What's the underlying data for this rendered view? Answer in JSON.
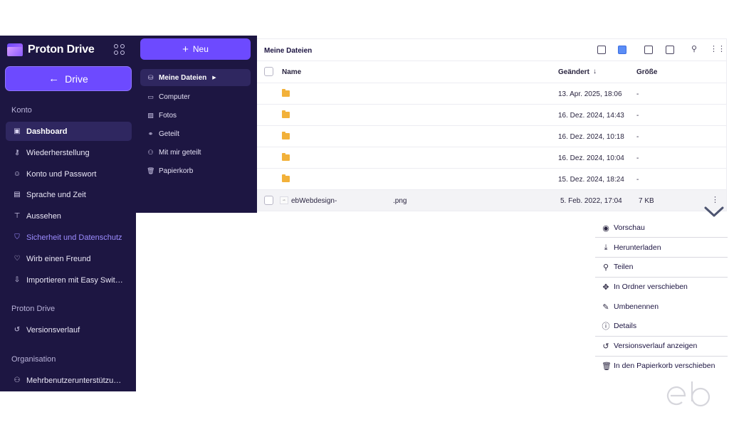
{
  "brand": {
    "name": "Proton Drive"
  },
  "sidebar": {
    "back_label": "Drive",
    "sections": {
      "konto": "Konto",
      "proton_drive": "Proton Drive",
      "organisation": "Organisation"
    },
    "items": [
      {
        "label": "Dashboard",
        "icon": "dashboard-icon"
      },
      {
        "label": "Wiederherstellung",
        "icon": "key-icon"
      },
      {
        "label": "Konto und Passwort",
        "icon": "user-icon"
      },
      {
        "label": "Sprache und Zeit",
        "icon": "language-icon"
      },
      {
        "label": "Aussehen",
        "icon": "paint-roller-icon"
      },
      {
        "label": "Sicherheit und Datenschutz",
        "icon": "shield-icon"
      },
      {
        "label": "Wirb einen Freund",
        "icon": "heart-icon"
      },
      {
        "label": "Importieren mit Easy Swit…",
        "icon": "import-icon"
      },
      {
        "label": "Versionsverlauf",
        "icon": "history-icon"
      },
      {
        "label": "Mehrbenutzerunterstützu…",
        "icon": "users-icon"
      }
    ]
  },
  "drive_nav": {
    "new_label": "Neu",
    "items": [
      {
        "label": "Meine Dateien",
        "icon": "drive-icon"
      },
      {
        "label": "Computer",
        "icon": "computer-icon"
      },
      {
        "label": "Fotos",
        "icon": "image-icon"
      },
      {
        "label": "Geteilt",
        "icon": "link-icon"
      },
      {
        "label": "Mit mir geteilt",
        "icon": "users-icon"
      },
      {
        "label": "Papierkorb",
        "icon": "trash-icon"
      }
    ]
  },
  "files": {
    "title": "Meine Dateien",
    "columns": {
      "name": "Name",
      "modified": "Geändert",
      "size": "Größe"
    },
    "rows": [
      {
        "type": "folder",
        "name": "",
        "modified": "13. Apr. 2025, 18:06",
        "size": "-"
      },
      {
        "type": "folder",
        "name": "",
        "modified": "16. Dez. 2024, 14:43",
        "size": "-"
      },
      {
        "type": "folder",
        "name": "",
        "modified": "16. Dez. 2024, 10:18",
        "size": "-"
      },
      {
        "type": "folder",
        "name": "",
        "modified": "16. Dez. 2024, 10:04",
        "size": "-"
      },
      {
        "type": "folder",
        "name": "",
        "modified": "15. Dez. 2024, 18:24",
        "size": "-"
      },
      {
        "type": "file",
        "name": "ebWebdesign-",
        "ext": ".png",
        "modified": "5. Feb. 2022, 17:04",
        "size": "7 KB"
      }
    ]
  },
  "context_menu": {
    "items": [
      {
        "label": "Vorschau",
        "icon": "eye-icon"
      },
      {
        "label": "Herunterladen",
        "icon": "download-icon"
      },
      {
        "label": "Teilen",
        "icon": "share-user-icon"
      },
      {
        "label": "In Ordner verschieben",
        "icon": "move-icon"
      },
      {
        "label": "Umbenennen",
        "icon": "pencil-icon"
      },
      {
        "label": "Details",
        "icon": "info-icon"
      },
      {
        "label": "Versionsverlauf anzeigen",
        "icon": "history-icon"
      },
      {
        "label": "In den Papierkorb verschieben",
        "icon": "trash-icon"
      }
    ]
  },
  "colors": {
    "sidebar_bg": "#1d1642",
    "accent": "#6d4aff",
    "folder": "#f2b13a"
  }
}
